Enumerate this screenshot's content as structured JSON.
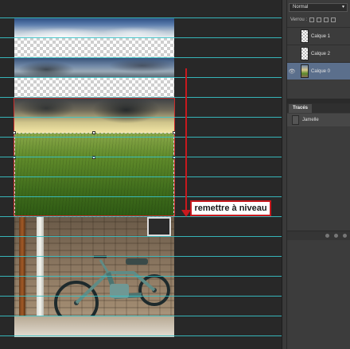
{
  "canvas": {
    "annotation": {
      "label": "remettre à niveau"
    }
  },
  "panels": {
    "layers": {
      "blend_mode": "Normal",
      "lock_label": "Verrou :",
      "layers": [
        {
          "name": "Calque 1",
          "selected": false,
          "visible": false,
          "thumb": "checker"
        },
        {
          "name": "Calque 2",
          "selected": false,
          "visible": false,
          "thumb": "checker"
        },
        {
          "name": "Calque 0",
          "selected": true,
          "visible": true,
          "thumb": "image"
        }
      ]
    },
    "paths": {
      "tab_label": "Tracés",
      "items": [
        {
          "name": "Jamelle"
        }
      ]
    }
  },
  "colors": {
    "guide": "#37c3c8",
    "annotation": "#c8191e",
    "selection_highlight": "#5b6f8c"
  }
}
